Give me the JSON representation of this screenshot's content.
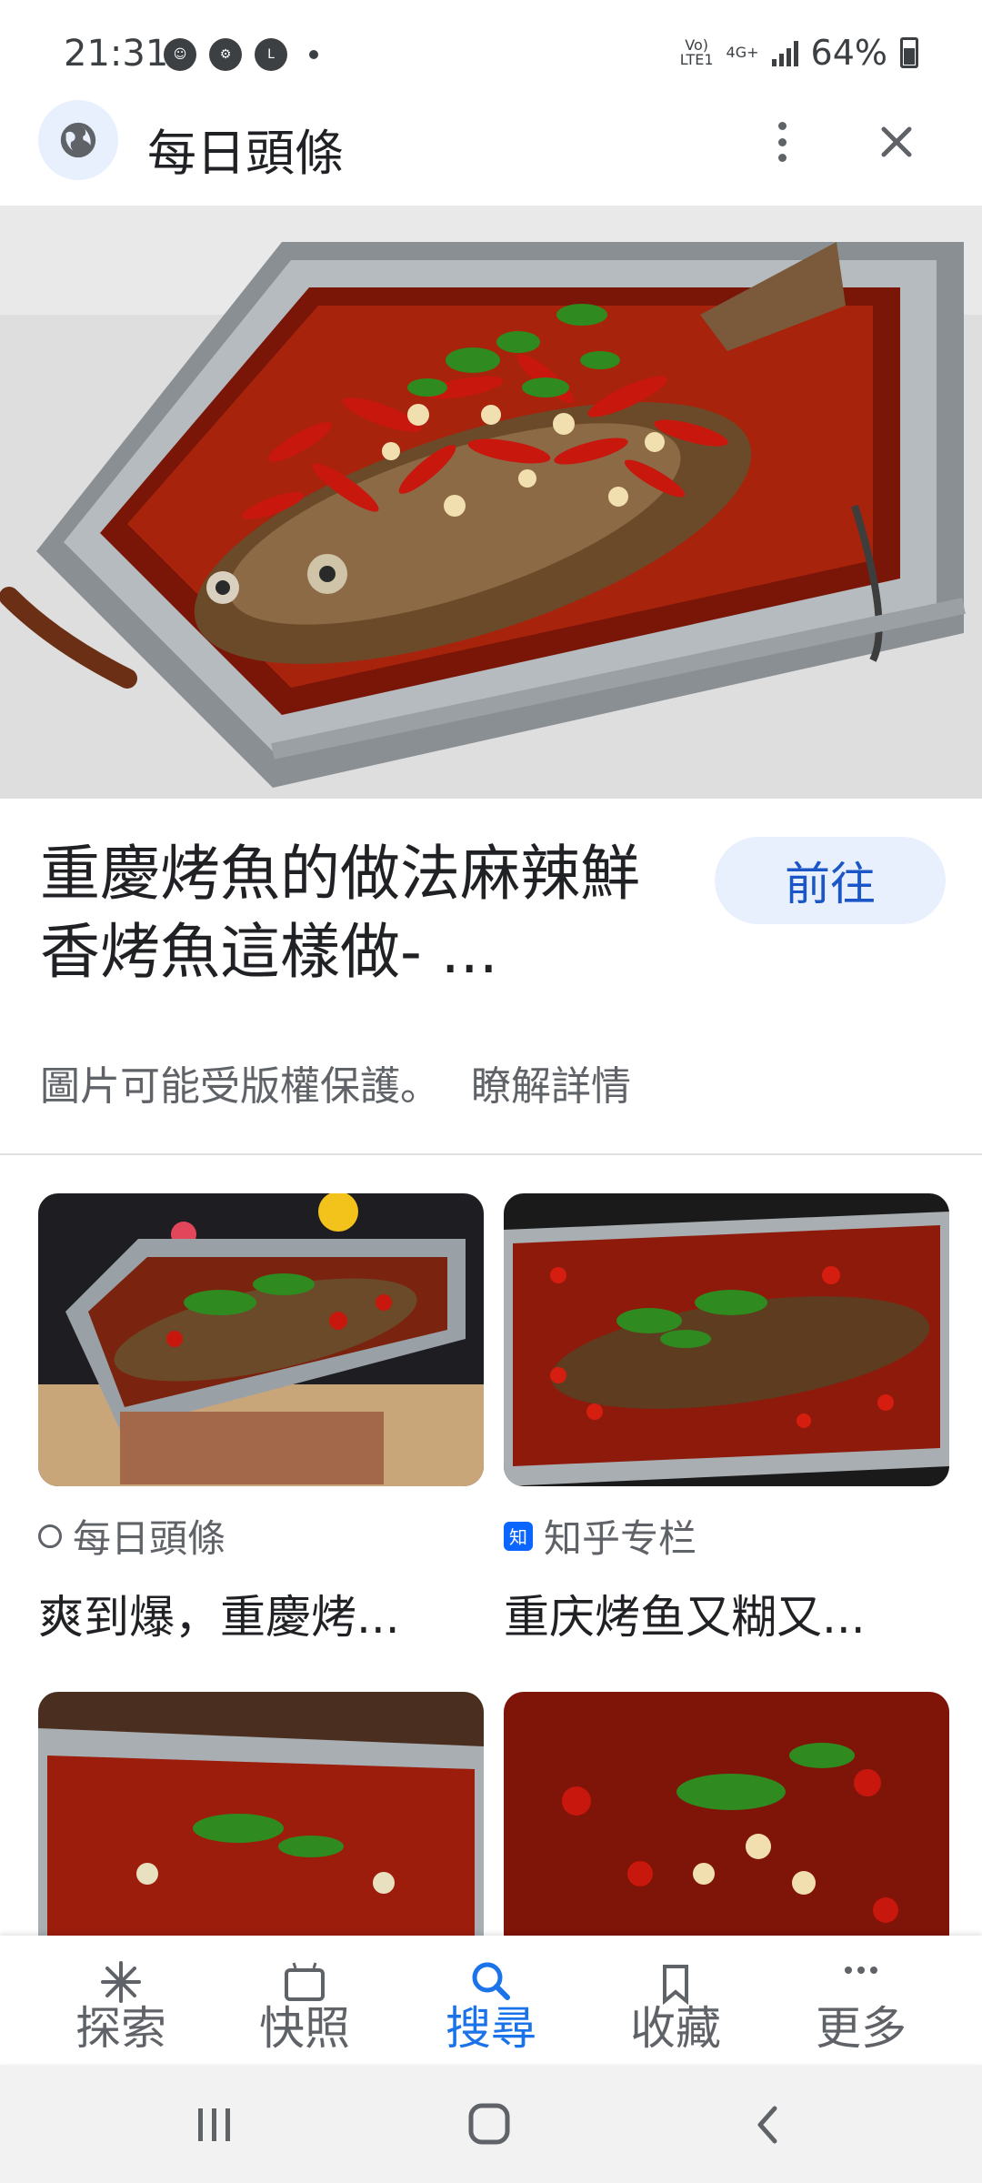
{
  "status_bar": {
    "time": "21:31",
    "network_top": "Vo)",
    "network_bottom": "LTE1",
    "network_type": "4G+",
    "battery": "64%"
  },
  "header": {
    "title": "每日頭條",
    "icons": [
      "globe-icon",
      "more-vert-icon",
      "close-icon"
    ]
  },
  "hero": {
    "title": "重慶烤魚的做法麻辣鮮香烤魚這樣做- ...",
    "go_button": "前往",
    "copyright_text": "圖片可能受版權保護。",
    "learn_more": "瞭解詳情"
  },
  "results": [
    {
      "source": "每日頭條",
      "source_icon": "globe-icon",
      "caption": "爽到爆，重慶烤..."
    },
    {
      "source": "知乎专栏",
      "source_icon": "zhihu-icon",
      "source_icon_text": "知",
      "caption": "重庆烤鱼又糊又..."
    }
  ],
  "bottom_nav": [
    {
      "label": "探索",
      "icon": "explore-icon"
    },
    {
      "label": "快照",
      "icon": "snapshot-icon"
    },
    {
      "label": "搜尋",
      "icon": "search-icon",
      "active": true
    },
    {
      "label": "收藏",
      "icon": "bookmark-icon"
    },
    {
      "label": "更多",
      "icon": "more-icon"
    }
  ],
  "colors": {
    "accent": "#1a73e8",
    "button_bg": "#e8f0fe",
    "muted_text": "#5f6368"
  }
}
